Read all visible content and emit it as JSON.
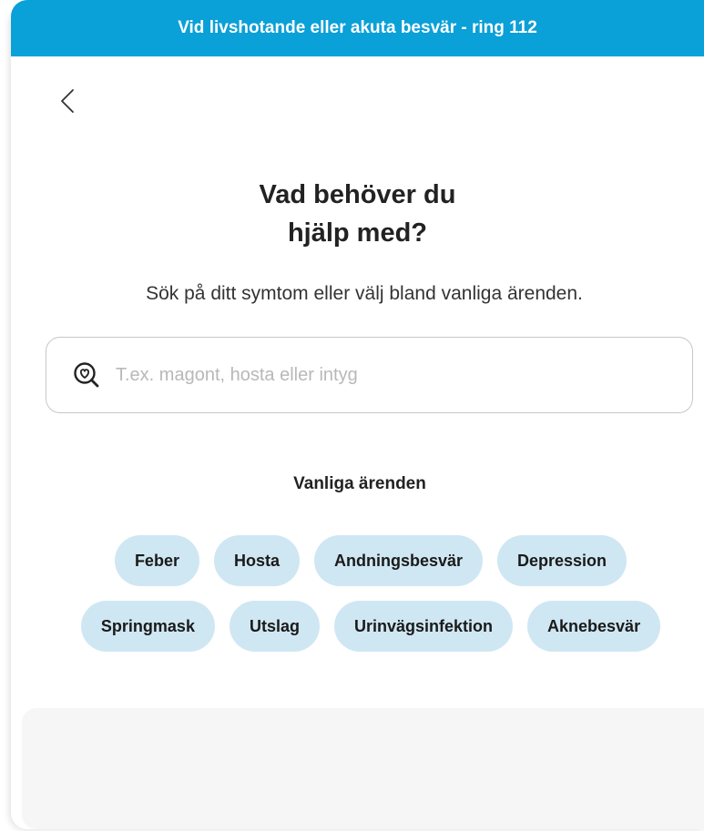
{
  "banner": {
    "text": "Vid livshotande eller akuta besvär - ring 112"
  },
  "nav": {
    "back_icon": "chevron-left-icon"
  },
  "heading": {
    "line1": "Vad behöver du",
    "line2": "hjälp med?"
  },
  "subtitle": "Sök på ditt symtom eller välj bland vanliga ärenden.",
  "search": {
    "icon": "heart-search-icon",
    "value": "",
    "placeholder": "T.ex. magont, hosta eller intyg"
  },
  "common": {
    "title": "Vanliga ärenden",
    "row1": [
      {
        "label": "Feber"
      },
      {
        "label": "Hosta"
      },
      {
        "label": "Andningsbesvär"
      },
      {
        "label": "Depression"
      }
    ],
    "row2": [
      {
        "label": "Springmask"
      },
      {
        "label": "Utslag"
      },
      {
        "label": "Urinvägsinfektion"
      },
      {
        "label": "Aknebesvär"
      }
    ]
  },
  "colors": {
    "banner": "#0aa0d8",
    "chip": "#cfe7f3",
    "footer": "#f6f6f7"
  }
}
